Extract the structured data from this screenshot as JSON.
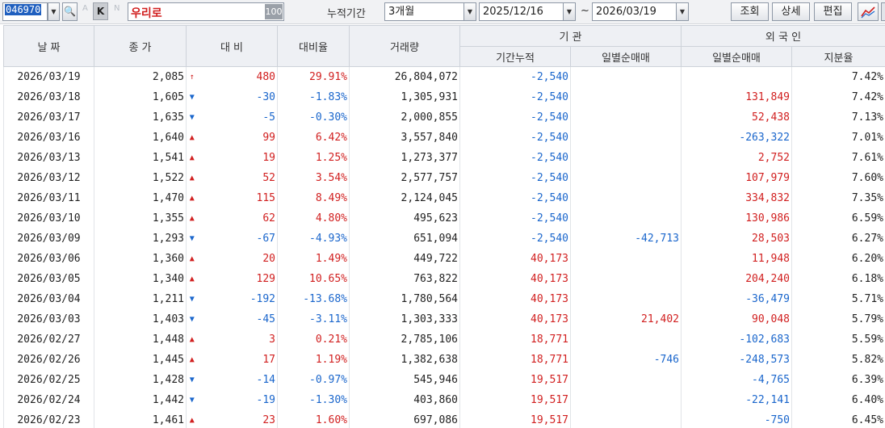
{
  "toolbar": {
    "stock_code": "046970",
    "letter_a": "A",
    "k_label": "K",
    "letter_n": "N",
    "stock_name": "우리로",
    "name_num": "100",
    "period_label": "누적기간",
    "period_value": "3개월",
    "start_date": "2025/12/16",
    "tilde": "~",
    "end_date": "2026/03/19",
    "query_label": "조회",
    "detail_label": "상세",
    "edit_label": "편집"
  },
  "headers": {
    "date": "날 짜",
    "close": "종 가",
    "change": "대 비",
    "change_rate": "대비율",
    "volume": "거래량",
    "institution": "기 관",
    "inst_cum": "기간누적",
    "inst_daily": "일별순매매",
    "foreign": "외 국 인",
    "foreign_daily": "일별순매매",
    "foreign_ratio": "지분율"
  },
  "colors": {
    "up": "#d11f1f",
    "down": "#1a66cc"
  },
  "rows": [
    {
      "date": "2026/03/19",
      "close": "2,085",
      "dir": "limit-up",
      "change": "480",
      "rate": "29.91%",
      "volume": "26,804,072",
      "inst_cum": "-2,540",
      "inst_daily": "",
      "frgn_daily": "",
      "frgn_ratio": "7.42%"
    },
    {
      "date": "2026/03/18",
      "close": "1,605",
      "dir": "down",
      "change": "-30",
      "rate": "-1.83%",
      "volume": "1,305,931",
      "inst_cum": "-2,540",
      "inst_daily": "",
      "frgn_daily": "131,849",
      "frgn_ratio": "7.42%"
    },
    {
      "date": "2026/03/17",
      "close": "1,635",
      "dir": "down",
      "change": "-5",
      "rate": "-0.30%",
      "volume": "2,000,855",
      "inst_cum": "-2,540",
      "inst_daily": "",
      "frgn_daily": "52,438",
      "frgn_ratio": "7.13%"
    },
    {
      "date": "2026/03/16",
      "close": "1,640",
      "dir": "up",
      "change": "99",
      "rate": "6.42%",
      "volume": "3,557,840",
      "inst_cum": "-2,540",
      "inst_daily": "",
      "frgn_daily": "-263,322",
      "frgn_ratio": "7.01%"
    },
    {
      "date": "2026/03/13",
      "close": "1,541",
      "dir": "up",
      "change": "19",
      "rate": "1.25%",
      "volume": "1,273,377",
      "inst_cum": "-2,540",
      "inst_daily": "",
      "frgn_daily": "2,752",
      "frgn_ratio": "7.61%"
    },
    {
      "date": "2026/03/12",
      "close": "1,522",
      "dir": "up",
      "change": "52",
      "rate": "3.54%",
      "volume": "2,577,757",
      "inst_cum": "-2,540",
      "inst_daily": "",
      "frgn_daily": "107,979",
      "frgn_ratio": "7.60%"
    },
    {
      "date": "2026/03/11",
      "close": "1,470",
      "dir": "up",
      "change": "115",
      "rate": "8.49%",
      "volume": "2,124,045",
      "inst_cum": "-2,540",
      "inst_daily": "",
      "frgn_daily": "334,832",
      "frgn_ratio": "7.35%"
    },
    {
      "date": "2026/03/10",
      "close": "1,355",
      "dir": "up",
      "change": "62",
      "rate": "4.80%",
      "volume": "495,623",
      "inst_cum": "-2,540",
      "inst_daily": "",
      "frgn_daily": "130,986",
      "frgn_ratio": "6.59%"
    },
    {
      "date": "2026/03/09",
      "close": "1,293",
      "dir": "down",
      "change": "-67",
      "rate": "-4.93%",
      "volume": "651,094",
      "inst_cum": "-2,540",
      "inst_daily": "-42,713",
      "frgn_daily": "28,503",
      "frgn_ratio": "6.27%"
    },
    {
      "date": "2026/03/06",
      "close": "1,360",
      "dir": "up",
      "change": "20",
      "rate": "1.49%",
      "volume": "449,722",
      "inst_cum": "40,173",
      "inst_daily": "",
      "frgn_daily": "11,948",
      "frgn_ratio": "6.20%"
    },
    {
      "date": "2026/03/05",
      "close": "1,340",
      "dir": "up",
      "change": "129",
      "rate": "10.65%",
      "volume": "763,822",
      "inst_cum": "40,173",
      "inst_daily": "",
      "frgn_daily": "204,240",
      "frgn_ratio": "6.18%"
    },
    {
      "date": "2026/03/04",
      "close": "1,211",
      "dir": "down",
      "change": "-192",
      "rate": "-13.68%",
      "volume": "1,780,564",
      "inst_cum": "40,173",
      "inst_daily": "",
      "frgn_daily": "-36,479",
      "frgn_ratio": "5.71%"
    },
    {
      "date": "2026/03/03",
      "close": "1,403",
      "dir": "down",
      "change": "-45",
      "rate": "-3.11%",
      "volume": "1,303,333",
      "inst_cum": "40,173",
      "inst_daily": "21,402",
      "frgn_daily": "90,048",
      "frgn_ratio": "5.79%"
    },
    {
      "date": "2026/02/27",
      "close": "1,448",
      "dir": "up",
      "change": "3",
      "rate": "0.21%",
      "volume": "2,785,106",
      "inst_cum": "18,771",
      "inst_daily": "",
      "frgn_daily": "-102,683",
      "frgn_ratio": "5.59%"
    },
    {
      "date": "2026/02/26",
      "close": "1,445",
      "dir": "up",
      "change": "17",
      "rate": "1.19%",
      "volume": "1,382,638",
      "inst_cum": "18,771",
      "inst_daily": "-746",
      "frgn_daily": "-248,573",
      "frgn_ratio": "5.82%"
    },
    {
      "date": "2026/02/25",
      "close": "1,428",
      "dir": "down",
      "change": "-14",
      "rate": "-0.97%",
      "volume": "545,946",
      "inst_cum": "19,517",
      "inst_daily": "",
      "frgn_daily": "-4,765",
      "frgn_ratio": "6.39%"
    },
    {
      "date": "2026/02/24",
      "close": "1,442",
      "dir": "down",
      "change": "-19",
      "rate": "-1.30%",
      "volume": "403,860",
      "inst_cum": "19,517",
      "inst_daily": "",
      "frgn_daily": "-22,141",
      "frgn_ratio": "6.40%"
    },
    {
      "date": "2026/02/23",
      "close": "1,461",
      "dir": "up",
      "change": "23",
      "rate": "1.60%",
      "volume": "697,086",
      "inst_cum": "19,517",
      "inst_daily": "",
      "frgn_daily": "-750",
      "frgn_ratio": "6.45%"
    }
  ]
}
